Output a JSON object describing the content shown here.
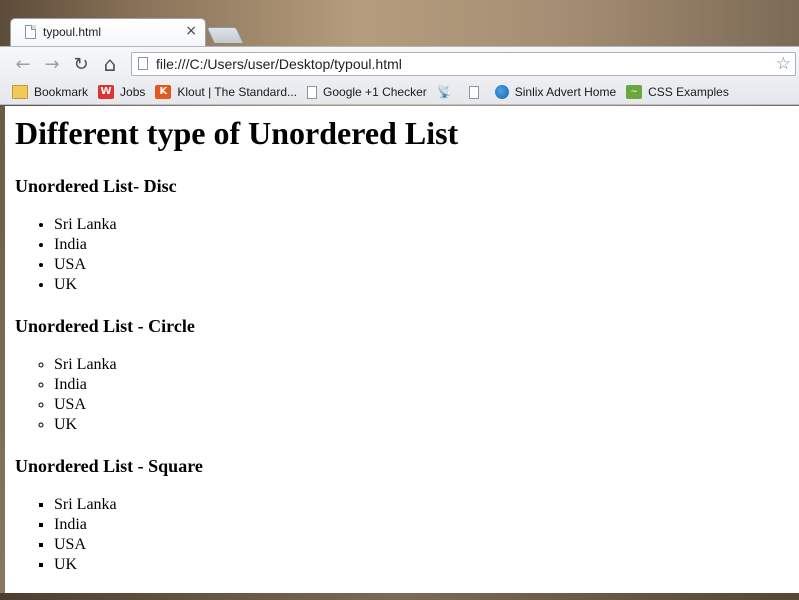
{
  "browser": {
    "tab_title": "typoul.html",
    "tab_close": "×",
    "url": "file:///C:/Users/user/Desktop/typoul.html",
    "nav": {
      "back": "←",
      "forward": "→",
      "reload": "↻",
      "home": "⌂"
    },
    "star": "☆",
    "bookmarks": [
      {
        "label": "Bookmark",
        "icon": "folder-icon"
      },
      {
        "label": "Jobs",
        "icon": "w-logo-icon"
      },
      {
        "label": "Klout | The Standard...",
        "icon": "klout-icon"
      },
      {
        "label": "Google +1 Checker",
        "icon": "page-icon"
      },
      {
        "label": "",
        "icon": "satellite-icon"
      },
      {
        "label": "",
        "icon": "page-icon"
      },
      {
        "label": "Sinlix Advert Home",
        "icon": "globe-icon"
      },
      {
        "label": "CSS Examples",
        "icon": "css-icon"
      }
    ]
  },
  "page": {
    "title": "Different type of Unordered List",
    "sections": [
      {
        "heading": "Unordered List- Disc",
        "style": "disc",
        "items": [
          "Sri Lanka",
          "India",
          "USA",
          "UK"
        ]
      },
      {
        "heading": "Unordered List - Circle",
        "style": "circle",
        "items": [
          "Sri Lanka",
          "India",
          "USA",
          "UK"
        ]
      },
      {
        "heading": "Unordered List - Square",
        "style": "square",
        "items": [
          "Sri Lanka",
          "India",
          "USA",
          "UK"
        ]
      }
    ]
  }
}
